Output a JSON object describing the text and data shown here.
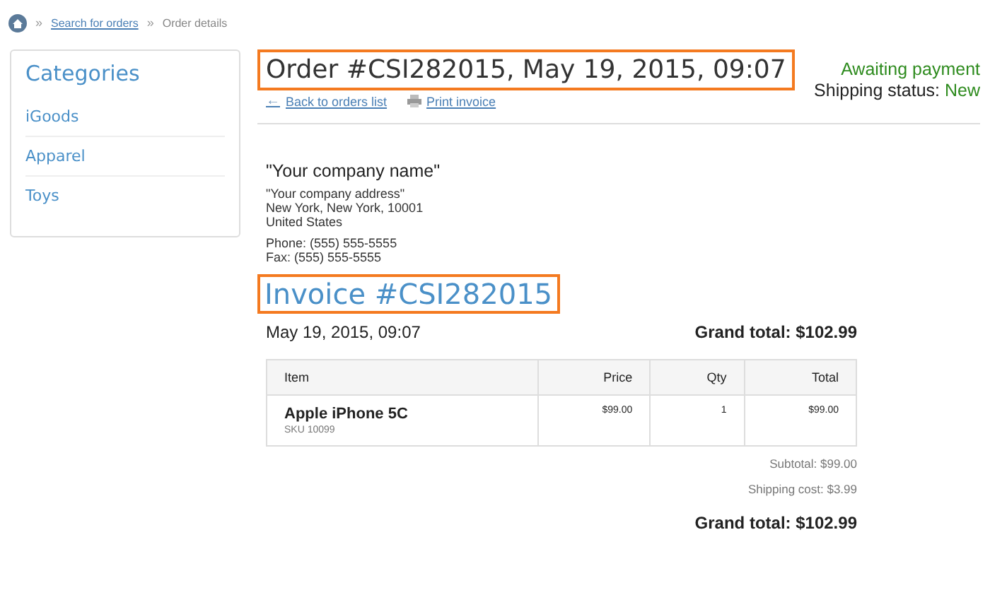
{
  "breadcrumb": [
    {
      "separator": "»",
      "label": "Search for orders",
      "link": true
    },
    {
      "separator": "»",
      "label": "Order details",
      "link": false
    }
  ],
  "sidebar": {
    "title": "Categories",
    "items": [
      {
        "label": "iGoods"
      },
      {
        "label": "Apparel"
      },
      {
        "label": "Toys"
      }
    ]
  },
  "order": {
    "title": "Order #CSI282015, May 19, 2015, 09:07",
    "highlighted": true,
    "payment_status": "Awaiting payment",
    "shipping_label": "Shipping status:",
    "shipping_status": "New",
    "links": [
      {
        "label": "Back to orders list",
        "kind": "back",
        "arrow": "←"
      },
      {
        "label": "Print invoice",
        "kind": "print"
      }
    ]
  },
  "company": {
    "name": "\"Your company name\"",
    "address": [
      "\"Your company address\"",
      "New York, New York, 10001",
      "United States"
    ],
    "contacts": [
      "Phone: (555) 555-5555",
      "Fax: (555) 555-5555"
    ]
  },
  "invoice": {
    "title": "Invoice #CSI282015",
    "highlighted": true,
    "date": "May 19, 2015, 09:07",
    "grand_total_top": "Grand total: $102.99",
    "table": {
      "columns": [
        "Item",
        "Price",
        "Qty",
        "Total"
      ],
      "rows": [
        {
          "name": "Apple iPhone 5C",
          "sku": "SKU 10099",
          "price": "$99.00",
          "qty": "1",
          "total": "$99.00"
        }
      ]
    },
    "subtotal": "Subtotal: $99.00",
    "shipping_cost": "Shipping cost: $3.99",
    "grand_total": "Grand total: $102.99"
  }
}
